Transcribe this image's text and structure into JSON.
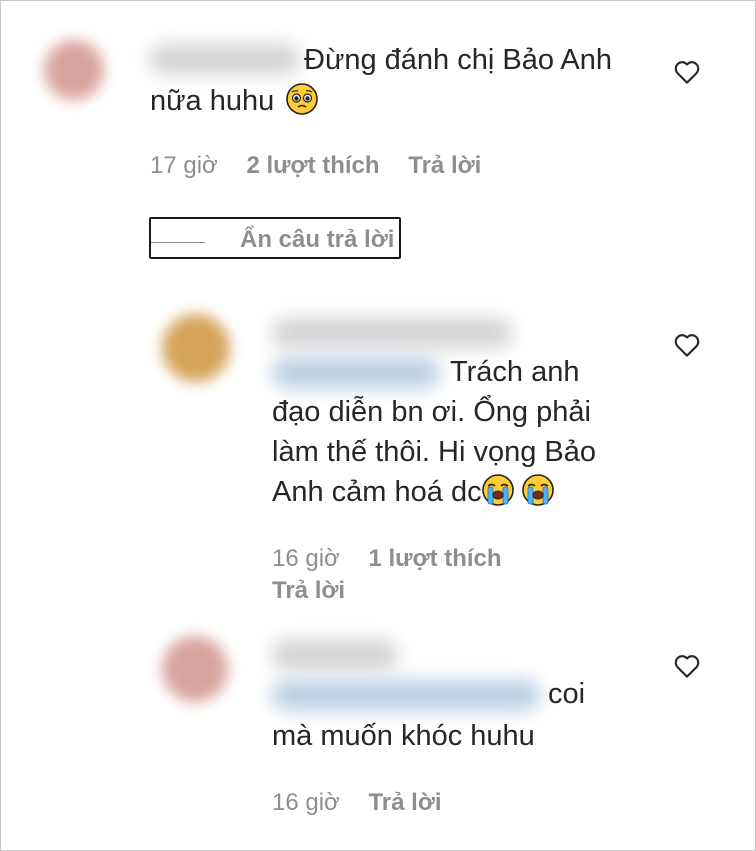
{
  "comments": [
    {
      "text_line1": "Đừng đánh chị Bảo Anh",
      "text_line2": "nữa huhu",
      "emoji": "pleading-face",
      "time": "17 giờ",
      "likes": "2 lượt thích",
      "reply": "Trả lời",
      "toggle_label": "Ẩn câu trả lời"
    },
    {
      "lines": [
        "Trách anh",
        "đạo diễn bn ơi. Ổng phải",
        "làm thế thôi. Hi vọng Bảo",
        "Anh cảm hoá dc"
      ],
      "emoji": "loudly-crying-face",
      "time": "16 giờ",
      "likes": "1 lượt thích",
      "reply": "Trả lời"
    },
    {
      "lines": [
        "coi",
        "mà muốn khóc huhu"
      ],
      "time": "16 giờ",
      "reply": "Trả lời"
    }
  ],
  "colors": {
    "text": "#262626",
    "meta": "#8e8e8e"
  },
  "icons": {
    "like": "heart-outline-icon"
  }
}
